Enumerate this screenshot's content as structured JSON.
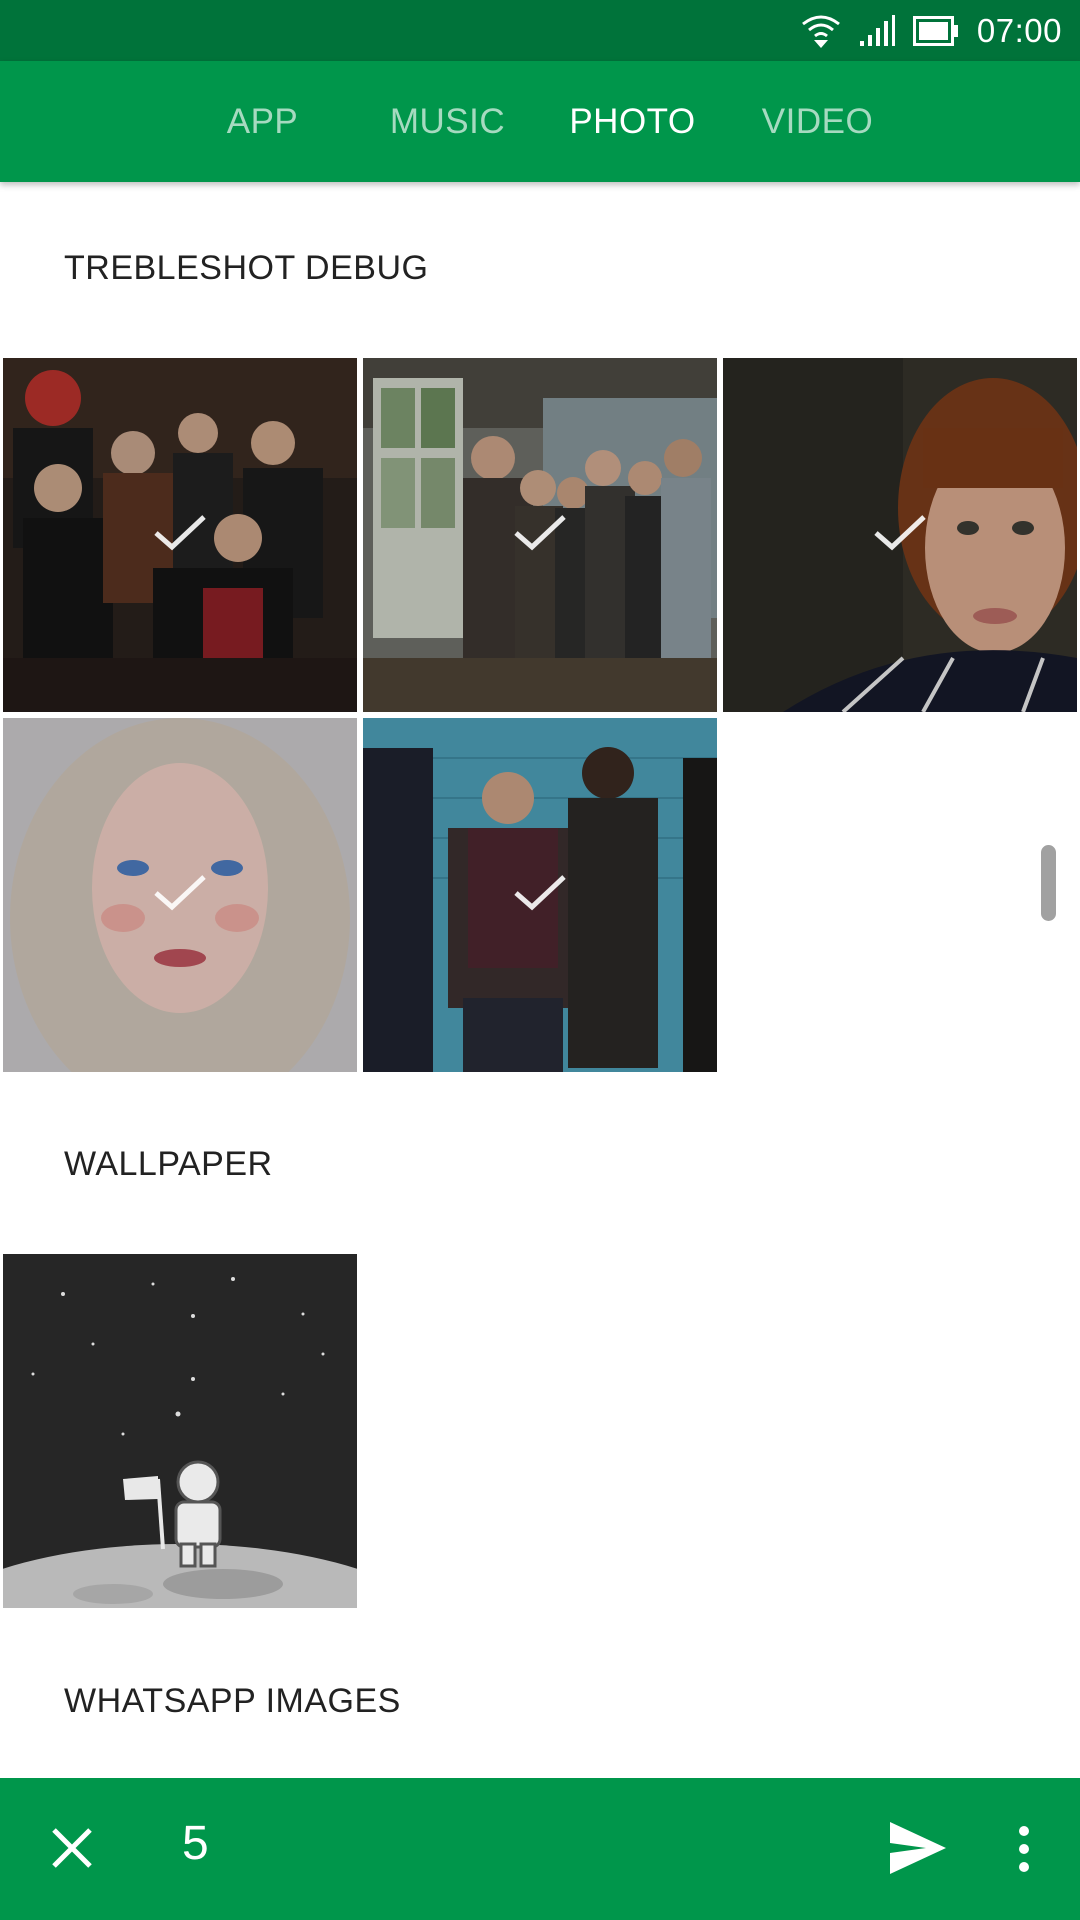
{
  "status_bar": {
    "time": "07:00",
    "icons": [
      "wifi-icon",
      "signal-icon",
      "battery-icon"
    ]
  },
  "tabs": [
    {
      "label": "APP",
      "active": false
    },
    {
      "label": "MUSIC",
      "active": false
    },
    {
      "label": "PHOTO",
      "active": true
    },
    {
      "label": "VIDEO",
      "active": false
    }
  ],
  "sections": [
    {
      "title": "TREBLESHOT DEBUG",
      "thumbnails": [
        {
          "subject": "band group photo in dark room",
          "selected": true
        },
        {
          "subject": "band standing by windows",
          "selected": true
        },
        {
          "subject": "portrait woman with bangs",
          "selected": true
        },
        {
          "subject": "portrait blonde woman",
          "selected": true
        },
        {
          "subject": "band against blue brick wall",
          "selected": true
        }
      ]
    },
    {
      "title": "WALLPAPER",
      "thumbnails": [
        {
          "subject": "astronaut on moon with flag",
          "selected": false
        }
      ]
    },
    {
      "title": "WHATSAPP IMAGES",
      "thumbnails": []
    }
  ],
  "action_bar": {
    "selected_count": "5",
    "icons": [
      "close-icon",
      "send-icon",
      "more-vert-icon"
    ]
  },
  "colors": {
    "status_bar": "#00733a",
    "primary": "#00964b",
    "indicator": "#39c36f"
  }
}
